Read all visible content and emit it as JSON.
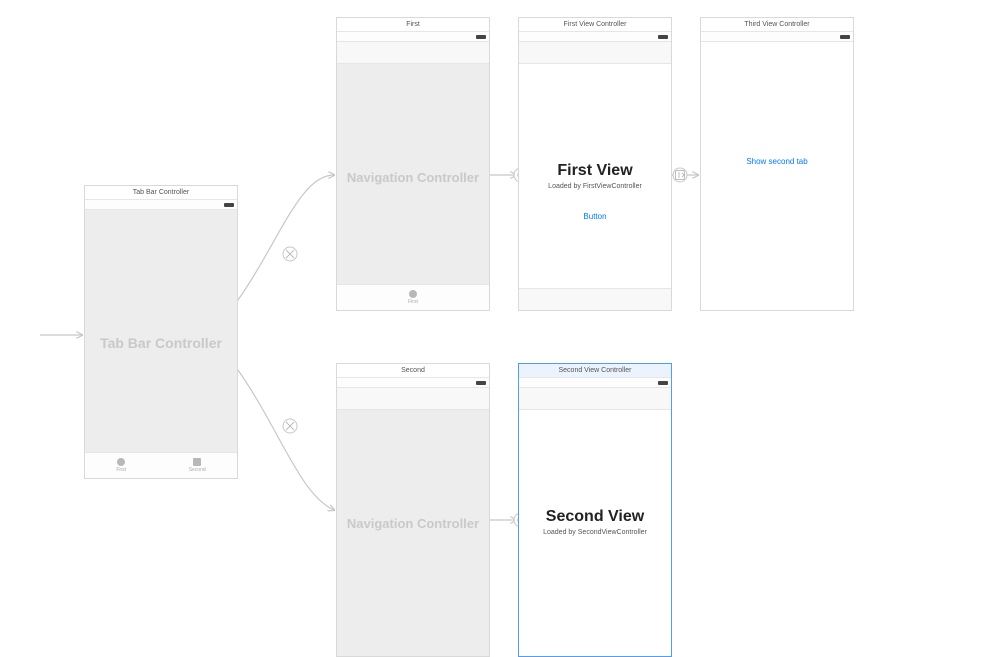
{
  "tabBarController": {
    "header": "Tab Bar Controller",
    "bodyLabel": "Tab Bar Controller",
    "tabs": [
      {
        "label": "First"
      },
      {
        "label": "Second"
      }
    ]
  },
  "navController1": {
    "header": "First",
    "bodyLabel": "Navigation Controller",
    "tab": {
      "label": "First"
    }
  },
  "navController2": {
    "header": "Second",
    "bodyLabel": "Navigation Controller"
  },
  "firstView": {
    "header": "First View Controller",
    "title": "First View",
    "subtitle": "Loaded by FirstViewController",
    "buttonLabel": "Button"
  },
  "secondView": {
    "header": "Second View Controller",
    "title": "Second View",
    "subtitle": "Loaded by SecondViewController"
  },
  "thirdView": {
    "header": "Third View Controller",
    "buttonLabel": "Show second tab"
  }
}
